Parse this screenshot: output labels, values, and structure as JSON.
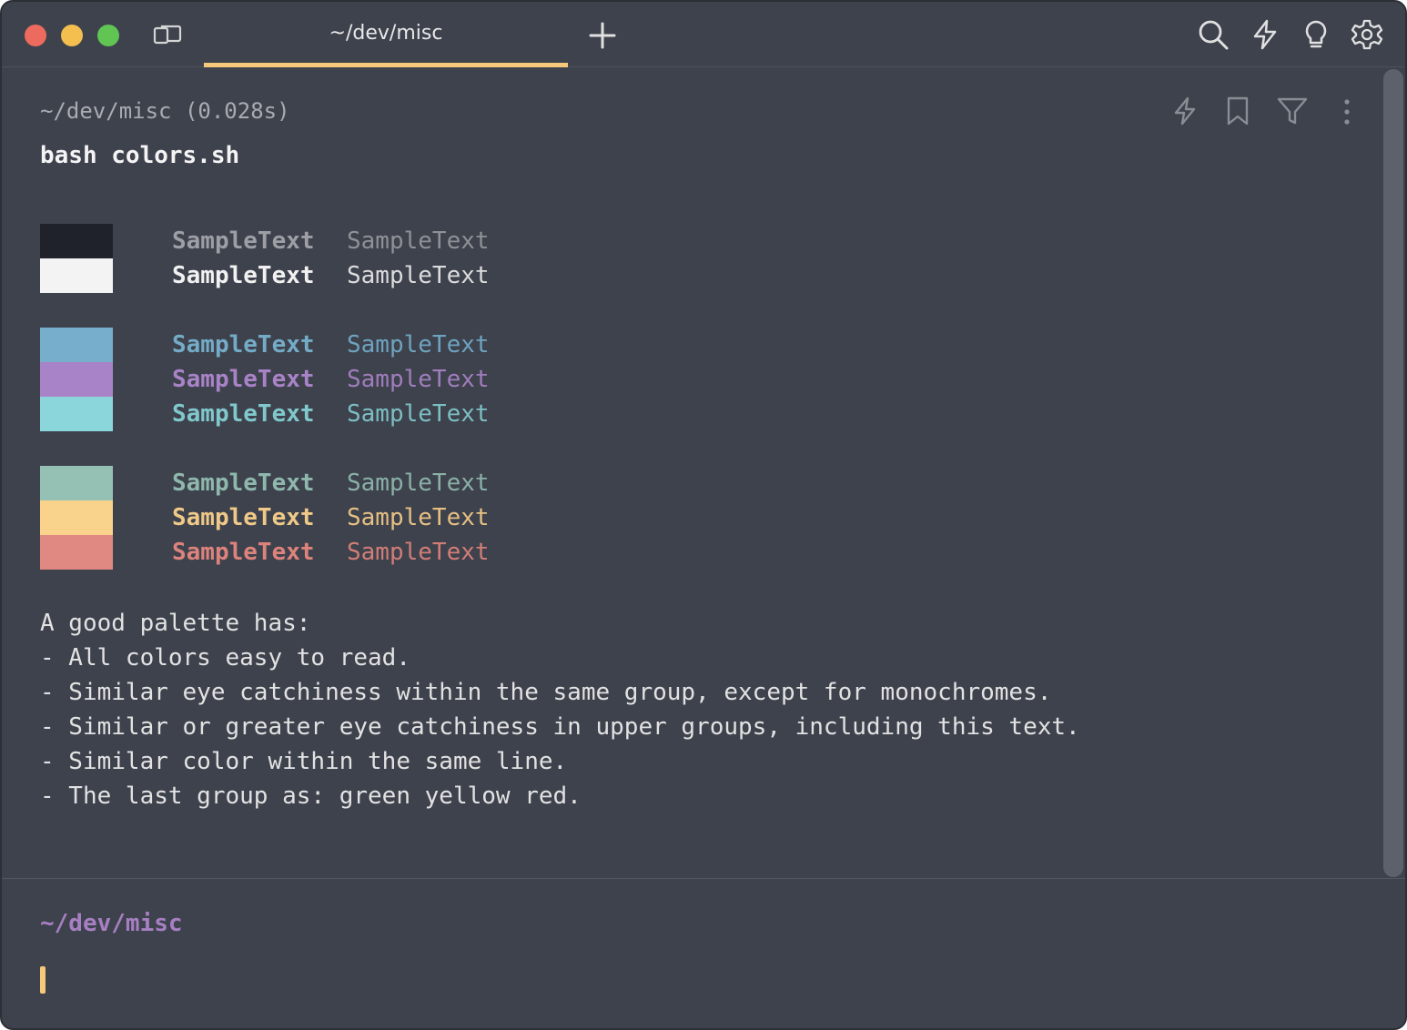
{
  "window": {
    "tab_title": "~/dev/misc"
  },
  "toolbar_icons": [
    "search-icon",
    "bolt-icon",
    "lightbulb-icon",
    "gear-icon"
  ],
  "block": {
    "header": "~/dev/misc (0.028s)",
    "command": "bash colors.sh",
    "action_icons": [
      "bolt-icon",
      "bookmark-icon",
      "filter-icon",
      "more-vertical-icon"
    ]
  },
  "palette": {
    "sample_text": "SampleText",
    "groups": [
      {
        "rows": [
          {
            "swatch": "#1f222b",
            "bold_color": "#9d9fa5",
            "normal_color": "#8f9197"
          },
          {
            "swatch": "#f3f3f3",
            "bold_color": "#f1f1f1",
            "normal_color": "#dcdcdc"
          }
        ]
      },
      {
        "rows": [
          {
            "swatch": "#76aecb",
            "bold_color": "#74acc8",
            "normal_color": "#6ea3bf"
          },
          {
            "swatch": "#a983c7",
            "bold_color": "#a983c7",
            "normal_color": "#a07dbc"
          },
          {
            "swatch": "#8ad6da",
            "bold_color": "#80c8cc",
            "normal_color": "#7cbfc3"
          }
        ]
      },
      {
        "rows": [
          {
            "swatch": "#95c1b5",
            "bold_color": "#8fb8ad",
            "normal_color": "#8ab1a7"
          },
          {
            "swatch": "#f9d38b",
            "bold_color": "#efc987",
            "normal_color": "#e6c083"
          },
          {
            "swatch": "#e08982",
            "bold_color": "#dd837c",
            "normal_color": "#d27d77"
          }
        ]
      }
    ]
  },
  "notes": [
    "A good palette has:",
    "- All colors easy to read.",
    "- Similar eye catchiness within the same group, except for monochromes.",
    "- Similar or greater eye catchiness in upper groups, including this text.",
    "- Similar color within the same line.",
    "- The last group as: green yellow red."
  ],
  "prompt": {
    "path": "~/dev/misc"
  },
  "colors": {
    "background": "#3e424d",
    "accent": "#f6c97a",
    "prompt_path": "#a77fc3"
  }
}
